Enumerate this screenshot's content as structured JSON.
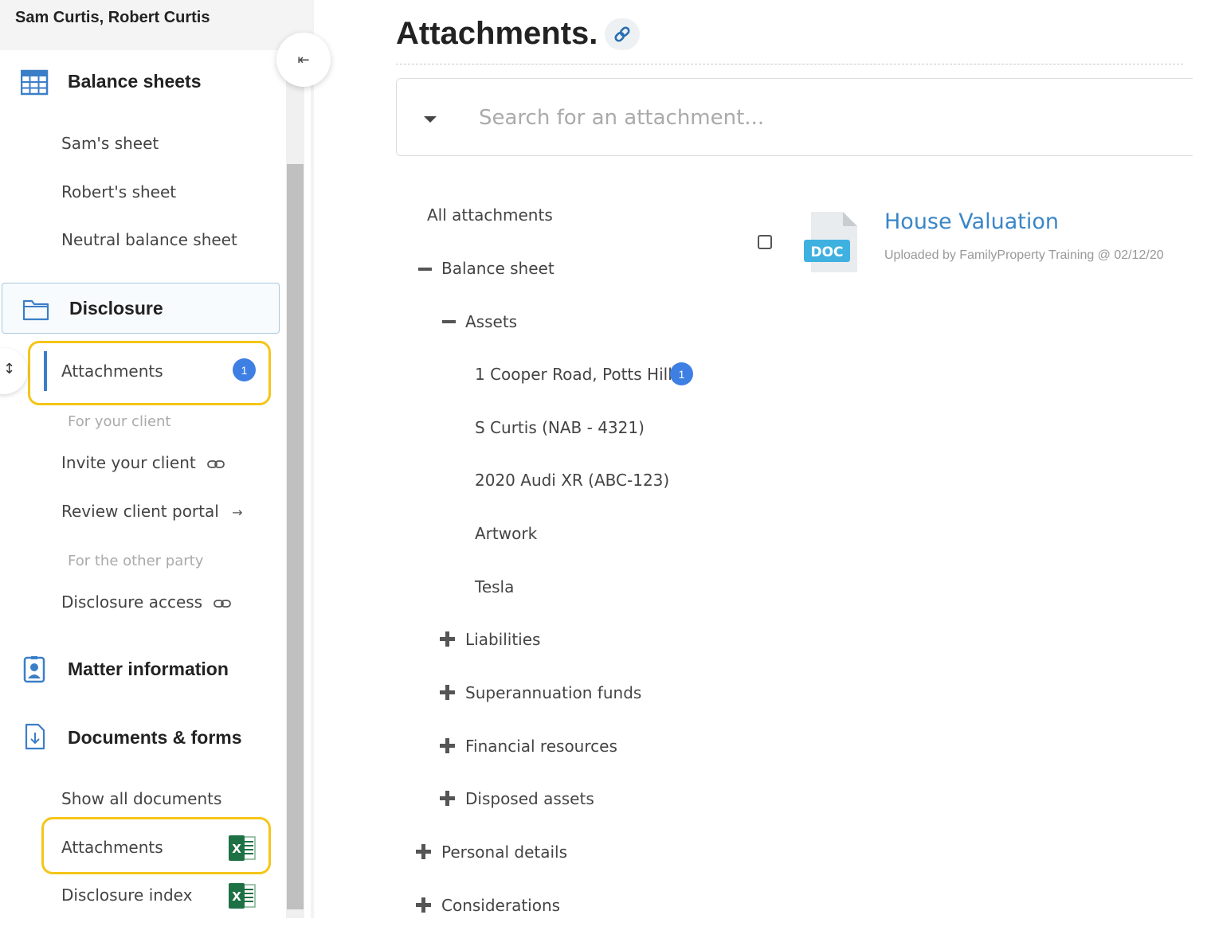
{
  "sidebar": {
    "client_names": "Sam Curtis, Robert Curtis",
    "collapse_icon": "collapse-left-icon",
    "balance_sheets": {
      "label": "Balance sheets",
      "icon": "table-grid-icon",
      "items": [
        "Sam's sheet",
        "Robert's sheet",
        "Neutral balance sheet"
      ]
    },
    "disclosure": {
      "label": "Disclosure",
      "icon": "folder-icon",
      "attachments_label": "Attachments",
      "attachments_count": "1",
      "for_client_label": "For your client",
      "invite_client": "Invite your client",
      "review_portal": "Review client portal",
      "for_other_label": "For the other party",
      "disclosure_access": "Disclosure access"
    },
    "matter_information": {
      "label": "Matter information",
      "icon": "id-badge-icon"
    },
    "documents_forms": {
      "label": "Documents & forms",
      "icon": "document-download-icon",
      "show_all": "Show all documents",
      "attachments": "Attachments",
      "disclosure_index": "Disclosure index"
    }
  },
  "main": {
    "title": "Attachments.",
    "search": {
      "placeholder": "Search for an attachment..."
    },
    "tree": {
      "all": "All attachments",
      "balance_sheet": "Balance sheet",
      "assets": "Assets",
      "asset_items": [
        {
          "label": "1 Cooper Road, Potts Hill...",
          "count": "1"
        },
        {
          "label": "S Curtis (NAB - 4321)"
        },
        {
          "label": "2020 Audi XR (ABC-123)"
        },
        {
          "label": "Artwork"
        },
        {
          "label": "Tesla"
        }
      ],
      "liabilities": "Liabilities",
      "superannuation": "Superannuation funds",
      "financial_resources": "Financial resources",
      "disposed_assets": "Disposed assets",
      "personal_details": "Personal details",
      "considerations": "Considerations"
    },
    "file": {
      "title": "House Valuation",
      "meta": "Uploaded by FamilyProperty Training @ 02/12/20",
      "type_label": "DOC"
    }
  },
  "colors": {
    "accent": "#3a86c8",
    "badge": "#3e7fe4",
    "highlight": "#f5c518",
    "excel_green": "#1e7145"
  }
}
